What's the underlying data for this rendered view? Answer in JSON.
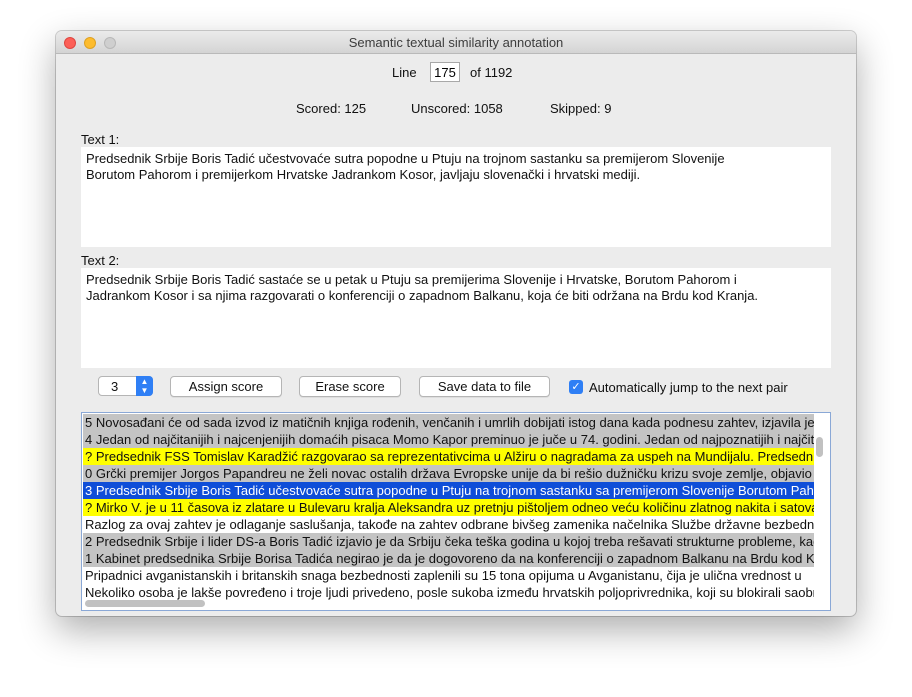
{
  "window": {
    "title": "Semantic textual similarity annotation"
  },
  "nav": {
    "line_label": "Line",
    "line_value": "175",
    "of_label": "of 1192"
  },
  "stats": {
    "scored": "Scored: 125",
    "unscored": "Unscored: 1058",
    "skipped": "Skipped: 9"
  },
  "text1": {
    "label": "Text 1:",
    "content": "Predsednik Srbije Boris Tadić učestvovaće sutra popodne u Ptuju na trojnom sastanku sa premijerom Slovenije\nBorutom Pahorom i premijerkom Hrvatske Jadrankom Kosor, javljaju slovenački i hrvatski mediji."
  },
  "text2": {
    "label": "Text 2:",
    "content": "Predsednik Srbije Boris Tadić sastaće se u petak u Ptuju sa premijerima Slovenije i Hrvatske, Borutom Pahorom i\nJadrankom Kosor i sa njima razgovarati o konferenciji o zapadnom Balkanu, koja će biti održana na Brdu kod Kranja."
  },
  "controls": {
    "score_value": "3",
    "assign_label": "Assign score",
    "erase_label": "Erase score",
    "save_label": "Save data to file",
    "auto_jump_label": "Automatically jump to the next pair",
    "auto_jump_checked": true
  },
  "colors": {
    "highlight_yellow": "#ffff00",
    "scored_gray": "#c4c4c4",
    "selected_blue": "#0f4ed8",
    "accent": "#2f7ff5"
  },
  "list": {
    "rows": [
      {
        "text": "5 Novosađani će od sada izvod iz matičnih knjiga rođenih, venčanih i umrlih dobijati istog dana kada podnesu zahtev, izjavila je",
        "state": "scored"
      },
      {
        "text": "4 Jedan od najčitanijih i najcenjenijih domaćih pisaca Momo Kapor preminuo je juče u 74. godini. Jedan od najpoznatijih i najčitanijih",
        "state": "scored"
      },
      {
        "text": "? Predsednik FSS Tomislav Karadžić razgovarao sa reprezentativcima u Alžiru o nagradama za uspeh na Mundijalu. Predsednik",
        "state": "skipped"
      },
      {
        "text": "0 Grčki premijer Jorgos Papandreu ne želi novac ostalih država Evropske unije da bi rešio dužničku krizu svoje zemlje, objavio je",
        "state": "scored"
      },
      {
        "text": "3 Predsednik Srbije Boris Tadić učestvovaće sutra popodne u Ptuju na trojnom sastanku sa premijerom Slovenije Borutom Pahorom",
        "state": "selected"
      },
      {
        "text": "? Mirko V. je u 11 časova iz zlatare u Bulevaru kralja Aleksandra uz pretnju pištoljem odneo veću količinu zlatnog nakita i satova",
        "state": "skipped"
      },
      {
        "text": "Razlog za ovaj zahtev je odlaganje saslušanja, takođe na zahtev odbrane bivšeg zamenika načelnika Službe državne bezbednosti",
        "state": "unscored"
      },
      {
        "text": "2 Predsednik Srbije i lider DS-a Boris Tadić izjavio je da Srbiju čeka teška godina u kojoj treba rešavati strukturne probleme, kao",
        "state": "scored"
      },
      {
        "text": "1 Kabinet predsednika Srbije Borisa Tadića negirao je da je dogovoreno da na konferenciji o zapadnom Balkanu na Brdu kod Kranja",
        "state": "scored"
      },
      {
        "text": "Pripadnici avganistanskih i britanskih snaga bezbednosti zaplenili su 15 tona opijuma u Avganistanu, čija je ulična vrednost u",
        "state": "unscored"
      },
      {
        "text": "Nekoliko osoba je lakše povređeno i troje ljudi privedeno, posle sukoba između hrvatskih poljoprivrednika, koji su blokirali saobraćaj",
        "state": "unscored"
      }
    ]
  }
}
